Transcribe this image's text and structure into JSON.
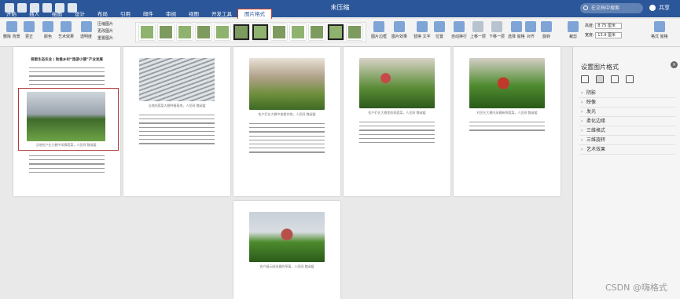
{
  "title_bar": {
    "doc_title": "未压缩",
    "search_placeholder": "在文档中搜索",
    "share_label": "共享",
    "icons": [
      "home-icon",
      "save-icon",
      "undo-icon",
      "redo-icon",
      "print-icon",
      "more-icon"
    ]
  },
  "ribbon_tabs": [
    {
      "label": "开始",
      "active": false
    },
    {
      "label": "插入",
      "active": false
    },
    {
      "label": "绘图",
      "active": false
    },
    {
      "label": "设计",
      "active": false
    },
    {
      "label": "布局",
      "active": false
    },
    {
      "label": "引用",
      "active": false
    },
    {
      "label": "邮件",
      "active": false
    },
    {
      "label": "审阅",
      "active": false
    },
    {
      "label": "视图",
      "active": false
    },
    {
      "label": "开发工具",
      "active": false
    },
    {
      "label": "图片格式",
      "active": true
    }
  ],
  "ribbon": {
    "remove_background": "删除\n背景",
    "corrections": "更正",
    "color": "颜色",
    "artistic_effects": "艺术效果",
    "transparency": "透明度",
    "compress": "压缩图片",
    "change_picture": "更改图片",
    "reset_picture": "重置图片",
    "picture_border": "图片边框",
    "picture_effects": "图片效果",
    "alt_text": "替换\n文字",
    "position": "位置",
    "wrap_text": "自动换行",
    "bring_forward": "上移一层",
    "send_backward": "下移一层",
    "selection_pane": "选择\n窗格",
    "align": "对齐",
    "rotate": "旋转",
    "crop": "裁剪",
    "height_label": "高度:",
    "height_value": "8.75 厘米",
    "width_label": "宽度:",
    "width_value": "13.9 厘米",
    "format_pane": "格式\n窗格"
  },
  "document": {
    "page1_title": "探索生态农业 | 助推乡村“旅游小镇”产业发展",
    "page1_caption": "当地农户在大棚中采摘蔬菜，人民网 魏淑媛",
    "page2_caption": "当地的蔬菜大棚种植基地，人民网 魏淑媛",
    "page3_caption": "农户们在大棚中查看作物，人民网 魏淑媛",
    "page4_caption": "农户们在大棚里收获蔬菜，人民网 魏淑媛",
    "page5_caption": "村民在大棚内采摘新鲜蔬菜，人民网 魏淑媛",
    "page6_caption": "农户展示刚采摘的草莓，人民网 魏淑媛"
  },
  "format_pane": {
    "title": "设置图片格式",
    "close_icon": "close-icon",
    "tab_icons": [
      "fill-line-icon",
      "effects-icon",
      "layout-size-icon",
      "picture-icon"
    ],
    "sections": [
      "阴影",
      "映像",
      "发光",
      "柔化边缘",
      "三维格式",
      "三维旋转",
      "艺术效果"
    ]
  },
  "watermark": "CSDN @嗨格式"
}
